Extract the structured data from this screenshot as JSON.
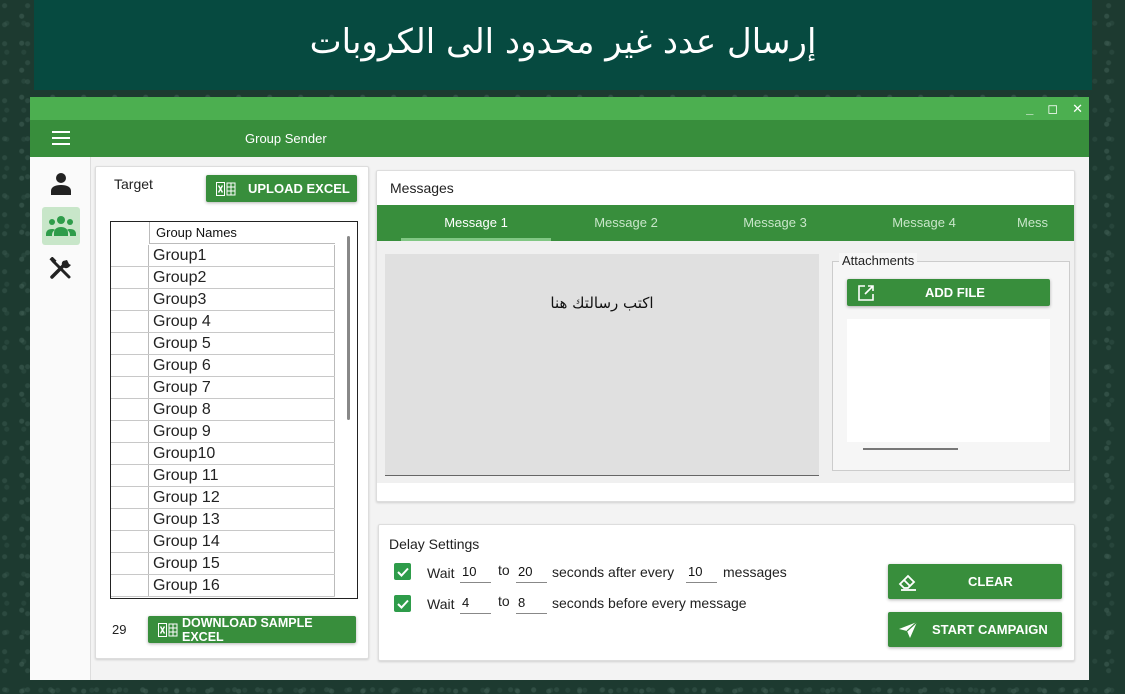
{
  "banner": {
    "title": "إرسال عدد غير محدود الى الكروبات"
  },
  "window": {
    "controls": {
      "minimize": "_",
      "maximize": "◻",
      "close": "✕"
    },
    "app_title": "Group Sender"
  },
  "sidebar": {
    "items": [
      {
        "icon": "person-icon",
        "active": false
      },
      {
        "icon": "group-icon",
        "active": true
      },
      {
        "icon": "tools-icon",
        "active": false
      }
    ]
  },
  "target": {
    "label": "Target",
    "upload_button": "UPLOAD EXCEL",
    "column_header": "Group Names",
    "groups": [
      "Group1",
      "Group2",
      "Group3",
      "Group 4",
      "Group 5",
      "Group 6",
      "Group 7",
      "Group 8",
      "Group 9",
      "Group10",
      "Group 11",
      "Group 12",
      "Group 13",
      "Group 14",
      "Group 15",
      "Group 16"
    ],
    "count": "29",
    "download_button": "DOWNLOAD SAMPLE EXCEL"
  },
  "messages": {
    "label": "Messages",
    "tabs": [
      "Message 1",
      "Message 2",
      "Message 3",
      "Message 4",
      "Mess"
    ],
    "active_tab": 0,
    "placeholder": "اكتب رسالتك هنا",
    "attachments_label": "Attachments",
    "add_file_button": "ADD FILE"
  },
  "delay": {
    "label": "Delay Settings",
    "row1": {
      "wait": "Wait",
      "from": "10",
      "to_label": "to",
      "to": "20",
      "after": "seconds after every",
      "every": "10",
      "unit": "messages"
    },
    "row2": {
      "wait": "Wait",
      "from": "4",
      "to_label": "to",
      "to": "8",
      "after": "seconds before every message"
    },
    "clear_button": "CLEAR",
    "start_button": "START CAMPAIGN"
  },
  "colors": {
    "primary": "#388e3c",
    "titlebar": "#4caf50",
    "banner": "#064a40"
  }
}
